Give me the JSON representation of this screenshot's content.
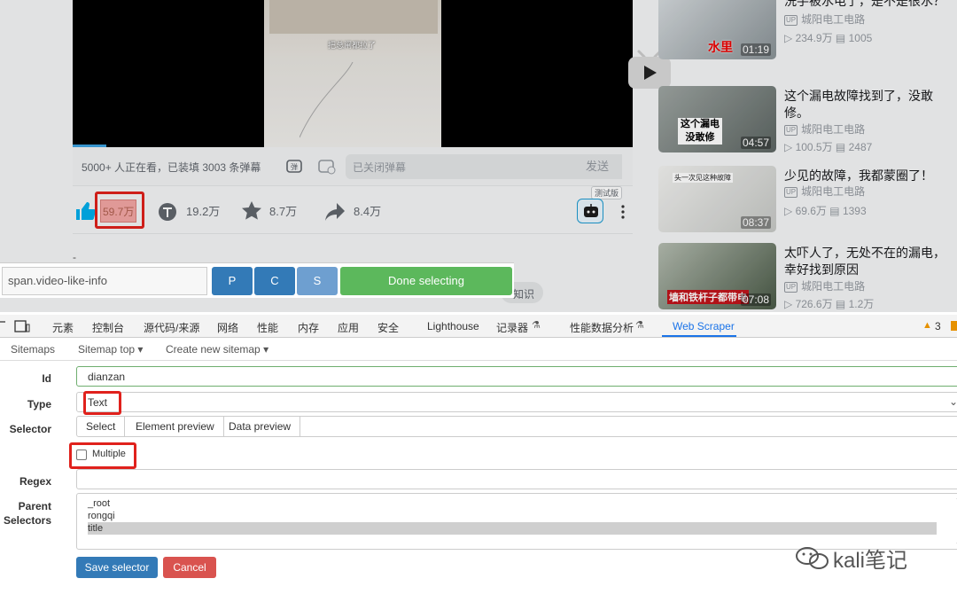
{
  "video": {
    "frame_caption": "把总闸都拉了",
    "online_text": "5000+ 人正在看，已装填 3003 条弹幕",
    "danmaku_placeholder": "已关闭弹幕",
    "send_label": "发送",
    "progress_fraction": 0.06
  },
  "stats": {
    "like": "59.7万",
    "coin": "19.2万",
    "fav": "8.7万",
    "share": "8.4万",
    "ai_tag": "测试版"
  },
  "recommendations": [
    {
      "title": "洗手被水电了，是不是很水？",
      "uploader": "城阳电工电路",
      "views": "234.9万",
      "danmaku": "1005",
      "duration": "01:19",
      "thumb_text": "水里"
    },
    {
      "title": "这个漏电故障找到了，没敢修。",
      "uploader": "城阳电工电路",
      "views": "100.5万",
      "danmaku": "2487",
      "duration": "04:57",
      "thumb_text": "这个漏电\n没敢修"
    },
    {
      "title": "少见的故障，我都蒙圈了！",
      "uploader": "城阳电工电路",
      "views": "69.6万",
      "danmaku": "1393",
      "duration": "08:37",
      "thumb_text": "头一次见这种故障"
    },
    {
      "title": "太吓人了，无处不在的漏电，幸好找到原因",
      "uploader": "城阳电工电路",
      "views": "726.6万",
      "danmaku": "1.2万",
      "duration": "07:08",
      "thumb_text": "墙和铁杆子都带电"
    }
  ],
  "badge_up": "UP",
  "selector_tool": {
    "selector_value": "span.video-like-info",
    "btn_p": "P",
    "btn_c": "C",
    "btn_s": "S",
    "done_label": "Done selecting",
    "partial_tag": "知识"
  },
  "devtools": {
    "tabs": [
      "元素",
      "控制台",
      "源代码/来源",
      "网络",
      "性能",
      "内存",
      "应用",
      "安全",
      "Lighthouse",
      "记录器",
      "性能数据分析",
      "Web Scraper"
    ],
    "warning_count": "3"
  },
  "scraper_nav": {
    "sitemaps": "Sitemaps",
    "sitemap_top": "Sitemap top",
    "create": "Create new sitemap"
  },
  "form": {
    "id_label": "Id",
    "id_value": "dianzan",
    "type_label": "Type",
    "type_value": "Text",
    "selector_label": "Selector",
    "selector_tabs": [
      "Select",
      "Element preview",
      "Data preview"
    ],
    "multiple_label": "Multiple",
    "multiple_checked": false,
    "regex_label": "Regex",
    "regex_value": "",
    "parent_label_1": "Parent",
    "parent_label_2": "Selectors",
    "parent_options": [
      "_root",
      "rongqi",
      "title"
    ],
    "parent_selected": "title",
    "save_label": "Save selector",
    "cancel_label": "Cancel"
  },
  "watermark": "kali笔记",
  "colors": {
    "accent_red": "#e0211c",
    "bili_blue": "#00aeec",
    "btn_blue": "#337ab7",
    "btn_green": "#5cb85c",
    "btn_red": "#d9534f",
    "btn_lightblue": "#6e9fd0"
  }
}
